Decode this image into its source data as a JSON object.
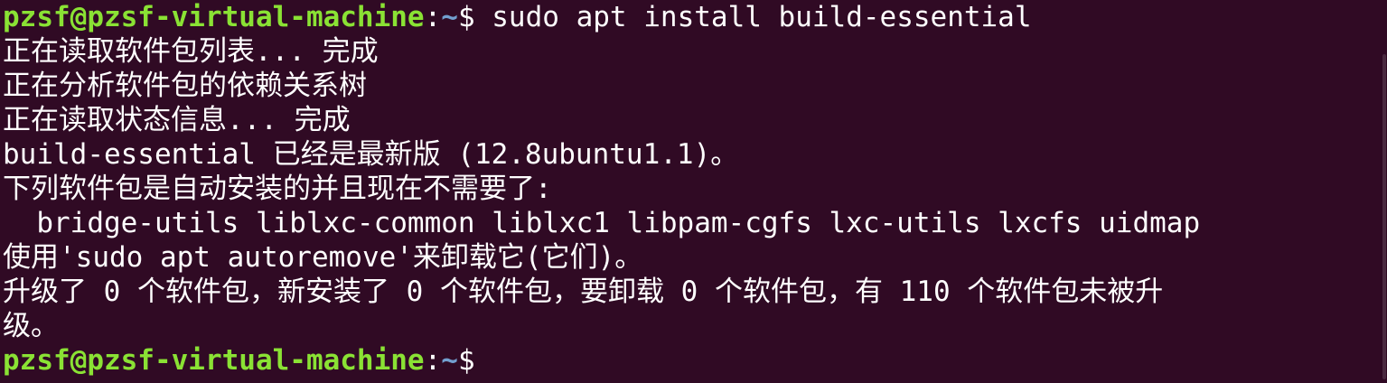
{
  "prompt": {
    "user_host": "pzsf@pzsf-virtual-machine",
    "separator": ":",
    "path": "~",
    "symbol": "$"
  },
  "command": " sudo apt install build-essential",
  "output": [
    "正在读取软件包列表... 完成",
    "正在分析软件包的依赖关系树",
    "正在读取状态信息... 完成",
    "build-essential 已经是最新版 (12.8ubuntu1.1)。",
    "下列软件包是自动安装的并且现在不需要了:",
    "  bridge-utils liblxc-common liblxc1 libpam-cgfs lxc-utils lxcfs uidmap",
    "使用'sudo apt autoremove'来卸载它(它们)。",
    "升级了 0 个软件包，新安装了 0 个软件包，要卸载 0 个软件包，有 110 个软件包未被升",
    "级。"
  ],
  "final_prompt": {
    "user_host": "pzsf@pzsf-virtual-machine",
    "separator": ":",
    "path": "~",
    "symbol": "$"
  },
  "colors": {
    "background": "#300a24",
    "user_host": "#8ae234",
    "path": "#729fcf",
    "text": "#ffffff"
  }
}
